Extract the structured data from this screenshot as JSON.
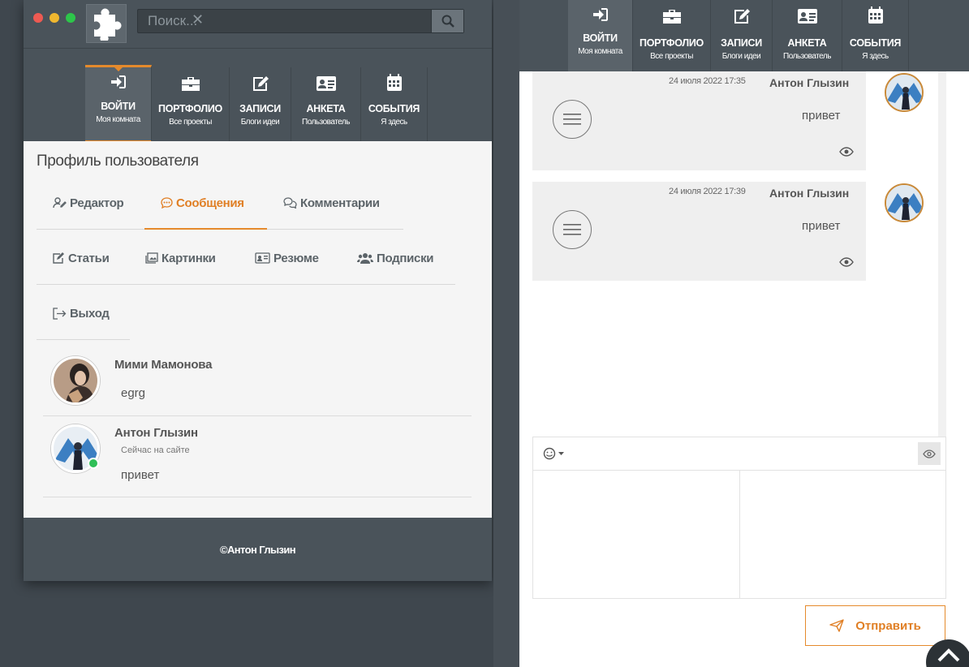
{
  "search": {
    "placeholder": "Поиск..."
  },
  "nav": [
    {
      "label": "ВОЙТИ",
      "sub": "Моя комната",
      "icon": "sign-in-icon"
    },
    {
      "label": "ПОРТФОЛИО",
      "sub": "Все проекты",
      "icon": "briefcase-icon"
    },
    {
      "label": "ЗАПИСИ",
      "sub": "Блоги идеи",
      "icon": "edit-icon"
    },
    {
      "label": "АНКЕТА",
      "sub": "Пользователь",
      "icon": "id-card-icon"
    },
    {
      "label": "СОБЫТИЯ",
      "sub": "Я здесь",
      "icon": "calendar-icon"
    }
  ],
  "profile": {
    "title": "Профиль пользователя",
    "tabs": [
      {
        "label": "Редактор",
        "icon": "user-edit-icon"
      },
      {
        "label": "Сообщения",
        "icon": "comment-dots-icon",
        "active": true
      },
      {
        "label": "Комментарии",
        "icon": "comments-icon"
      },
      {
        "label": "Статьи",
        "icon": "edit-icon"
      },
      {
        "label": "Картинки",
        "icon": "images-icon"
      },
      {
        "label": "Резюме",
        "icon": "id-card-icon"
      },
      {
        "label": "Подписки",
        "icon": "users-icon"
      },
      {
        "label": "Выход",
        "icon": "sign-out-icon"
      }
    ]
  },
  "conversations": [
    {
      "name": "Мими Мамонова",
      "text": "egrg"
    },
    {
      "name": "Антон Глызин",
      "status": "Сейчас на сайте",
      "text": "привет",
      "online": true
    }
  ],
  "footer": {
    "text": "©Антон Глызин"
  },
  "chat": {
    "messages": [
      {
        "date": "24 июля 2022 17:35",
        "name": "Антон Глызин",
        "text": "привет"
      },
      {
        "date": "24 июля 2022 17:39",
        "name": "Антон Глызин",
        "text": "привет"
      }
    ],
    "send_label": "Отправить"
  },
  "colors": {
    "accent": "#e58a2c",
    "nav_bg": "#4a535a",
    "online": "#2fbf57"
  }
}
